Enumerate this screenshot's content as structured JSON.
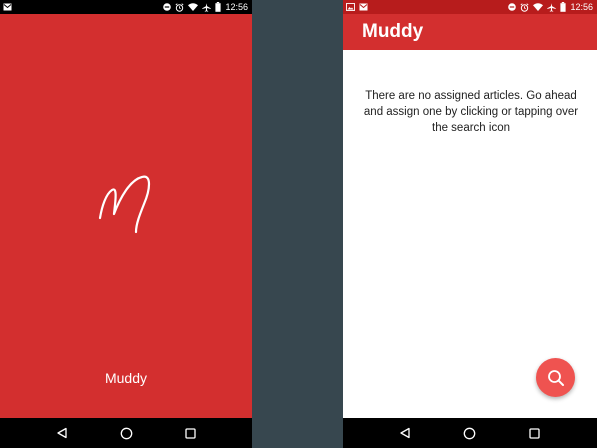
{
  "colors": {
    "brand_red": "#d32f2f",
    "status_bar_dark_red": "#b71c1c",
    "fab_red": "#ef5350",
    "background_slate": "#37474f",
    "nav_black": "#000000"
  },
  "status_bar": {
    "time": "12:56",
    "left_icons": [
      "image-notification-icon",
      "mail-notification-icon"
    ],
    "right_icons": [
      "do-not-disturb-icon",
      "alarm-icon",
      "wifi-icon",
      "airplane-mode-icon",
      "battery-icon"
    ]
  },
  "splash_screen": {
    "logo_icon": "muddy-logo-icon",
    "app_name": "Muddy"
  },
  "main_screen": {
    "app_bar_title": "Muddy",
    "empty_message": "There are no assigned articles. Go ahead and assign one by clicking or tapping over the search icon",
    "fab_icon": "search-icon"
  },
  "nav_bar": {
    "icons": [
      "back-icon",
      "home-icon",
      "recents-icon"
    ]
  }
}
